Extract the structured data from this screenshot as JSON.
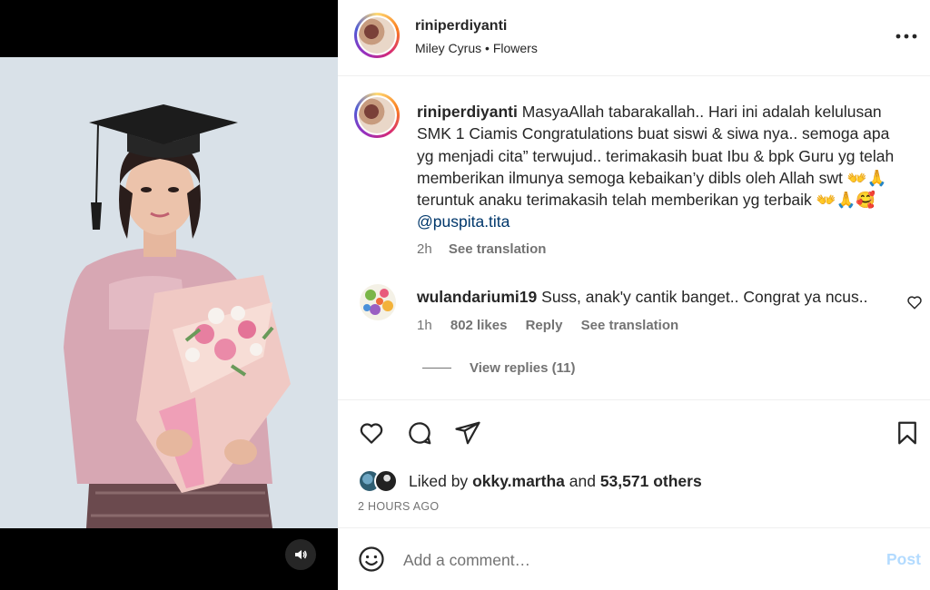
{
  "post": {
    "username": "riniperdiyanti",
    "audio_artist": "Miley Cyrus",
    "audio_separator": "•",
    "audio_track": "Flowers"
  },
  "caption": {
    "username": "riniperdiyanti",
    "text": "MasyaAllah tabarakallah.. Hari ini adalah kelulusan SMK 1 Ciamis Congratulations buat siswi & siwa nya.. semoga apa yg menjadi cita” terwujud.. terimakasih buat Ibu & bpk Guru yg telah memberikan ilmunya semoga kebaikan’y dibls oleh Allah swt 👐🙏 teruntuk anaku terimakasih telah memberikan yg terbaik 👐🙏🥰",
    "mention": "@puspita.tita",
    "time": "2h",
    "see_translation": "See translation"
  },
  "comment": {
    "username": "wulandariumi19",
    "text": "Suss, anak'y cantik banget.. Congrat ya ncus..",
    "time": "1h",
    "likes": "802 likes",
    "reply": "Reply",
    "see_translation": "See translation",
    "view_replies": "View replies (11)"
  },
  "likes": {
    "prefix": "Liked by",
    "user": "okky.martha",
    "and": "and",
    "others": "53,571 others"
  },
  "timestamp": "2 HOURS AGO",
  "add_comment": {
    "placeholder": "Add a comment…",
    "post_label": "Post"
  },
  "icons": {
    "more": "more-options-icon",
    "heart": "heart-icon",
    "comment": "comment-icon",
    "share": "share-icon",
    "save": "bookmark-icon",
    "emoji": "emoji-icon",
    "volume": "volume-icon"
  },
  "colors": {
    "link": "#00376b",
    "secondary_text": "#737373",
    "post_disabled": "#b3dbff",
    "media_bg": "#000000"
  }
}
